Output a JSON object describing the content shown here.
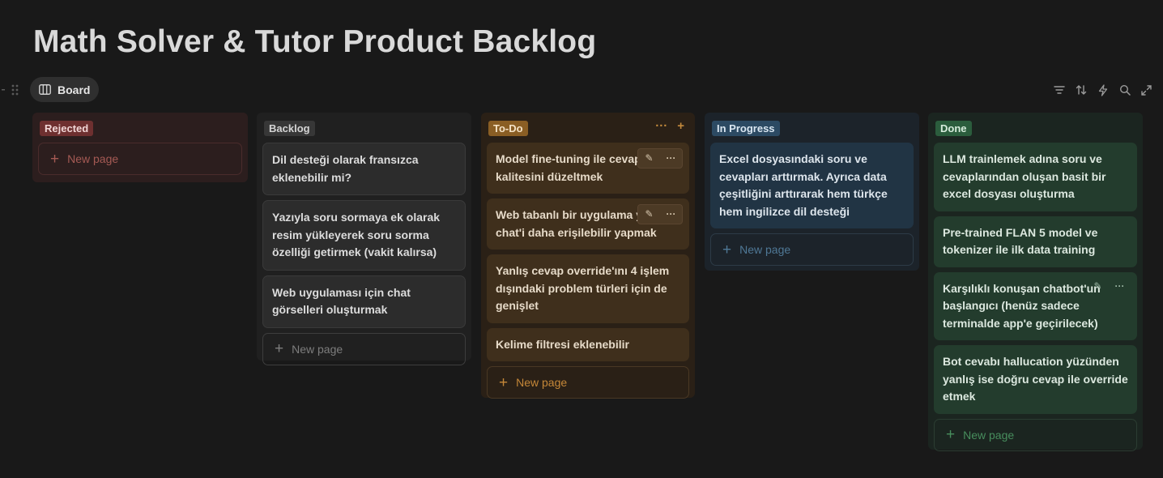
{
  "page": {
    "title": "Math Solver & Tutor Product Backlog"
  },
  "view": {
    "tab_label": "Board"
  },
  "toolbar": {
    "icons": [
      "filter-icon",
      "sort-icon",
      "lightning-icon",
      "search-icon",
      "expand-icon"
    ]
  },
  "board": {
    "new_page_label": "New page",
    "columns": [
      {
        "name": "Rejected",
        "color": "#6e3030",
        "cards": []
      },
      {
        "name": "Backlog",
        "color": "#373737",
        "cards": [
          "Dil desteği olarak fransızca eklenebilir mi?",
          "Yazıyla soru sormaya ek olarak resim yükleyerek soru sorma özelliği getirmek (vakit kalırsa)",
          "Web uygulaması için chat görselleri oluşturmak"
        ]
      },
      {
        "name": "To-Do",
        "color": "#8a5e24",
        "cards": [
          " Model fine-tuning ile cevap kalitesini düzeltmek",
          "Web tabanlı bir uygulama yaparak chat'i daha erişilebilir yapmak",
          "Yanlış cevap override'ını 4 işlem dışındaki problem türleri için de genişlet",
          "Kelime filtresi eklenebilir"
        ]
      },
      {
        "name": "In Progress",
        "color": "#2c4a63",
        "cards": [
          " Excel dosyasındaki soru ve cevapları arttırmak. Ayrıca data çeşitliğini arttırarak hem türkçe hem ingilizce dil desteği"
        ]
      },
      {
        "name": "Done",
        "color": "#2b5d3d",
        "cards": [
          "LLM trainlemek adına soru ve cevaplarından oluşan basit bir excel dosyası oluşturma",
          "Pre-trained FLAN 5 model ve tokenizer ile ilk data training",
          "Karşılıklı konuşan chatbot'un başlangıcı (henüz sadece terminalde app'e geçirilecek)",
          "Bot cevabı hallucation yüzünden yanlış ise doğru cevap ile override etmek"
        ]
      }
    ]
  }
}
